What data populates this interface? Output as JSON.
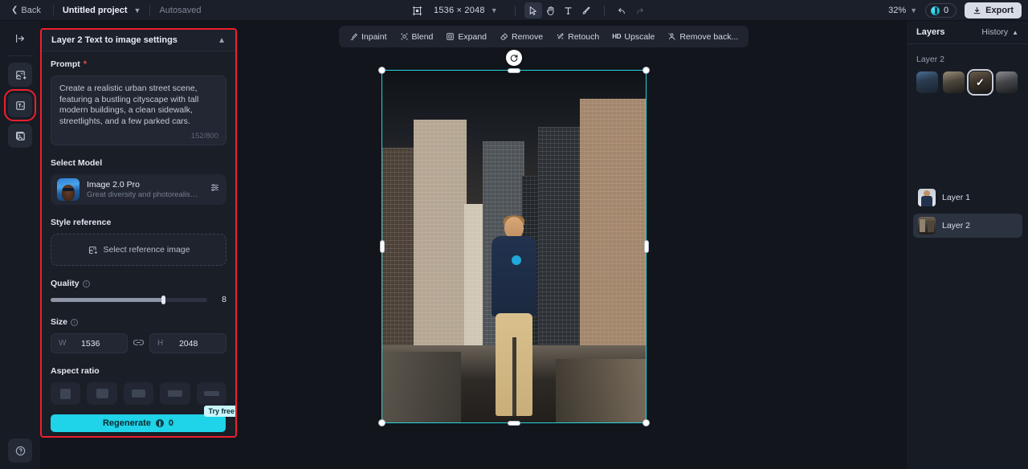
{
  "topbar": {
    "back_label": "Back",
    "project_name": "Untitled project",
    "autosaved_label": "Autosaved",
    "canvas_icon": "canvas-frame-icon",
    "dimensions": "1536 × 2048",
    "tools": [
      {
        "name": "select-tool",
        "glyph": "cursor"
      },
      {
        "name": "hand-tool",
        "glyph": "hand"
      },
      {
        "name": "text-tool",
        "glyph": "T"
      },
      {
        "name": "brush-tool",
        "glyph": "brush"
      }
    ],
    "undo_icon": "undo-icon",
    "redo_icon": "redo-icon",
    "zoom_level": "32%",
    "credits": "0",
    "export_label": "Export"
  },
  "rail": {
    "collapse_icon": "panel-collapse-icon",
    "tools": [
      {
        "name": "image-upload-tool",
        "icon": "image-plus-icon"
      },
      {
        "name": "text-to-image-tool",
        "icon": "text-to-image-icon"
      },
      {
        "name": "image-to-image-tool",
        "icon": "image-to-image-icon"
      }
    ],
    "help_icon": "help-icon"
  },
  "settings_panel": {
    "title": "Layer 2 Text to image settings",
    "collapse_icon": "chevron-up-icon",
    "prompt": {
      "label": "Prompt",
      "required_marker": "*",
      "value": "Create a realistic urban street scene, featuring a bustling cityscape with tall modern buildings, a clean sidewalk, streetlights, and a few parked cars.",
      "counter": "152/800"
    },
    "model": {
      "label": "Select Model",
      "name": "Image 2.0 Pro",
      "description": "Great diversity and photorealism. Of...",
      "settings_icon": "sliders-icon"
    },
    "style_reference": {
      "label": "Style reference",
      "placeholder": "Select reference image",
      "icon": "image-plus-icon"
    },
    "quality": {
      "label": "Quality",
      "info_icon": "info-icon",
      "value": "8",
      "percent": 72
    },
    "size": {
      "label": "Size",
      "info_icon": "info-icon",
      "width_key": "W",
      "width_value": "1536",
      "link_icon": "link-icon",
      "height_key": "H",
      "height_value": "2048"
    },
    "aspect_ratio": {
      "label": "Aspect ratio",
      "options": [
        "1:1",
        "4:5",
        "3:4",
        "3:2",
        "16:9"
      ]
    },
    "regenerate": {
      "label": "Regenerate",
      "cost": "0",
      "coin_icon": "coin-icon",
      "badge": "Try free"
    }
  },
  "edit_toolbar": {
    "items": [
      {
        "label": "Inpaint",
        "icon": "inpaint-icon"
      },
      {
        "label": "Blend",
        "icon": "blend-icon"
      },
      {
        "label": "Expand",
        "icon": "expand-icon"
      },
      {
        "label": "Remove",
        "icon": "eraser-icon"
      },
      {
        "label": "Retouch",
        "icon": "magic-wand-icon"
      },
      {
        "label": "Upscale",
        "icon": "hd-icon",
        "tag": "HD"
      },
      {
        "label": "Remove back...",
        "icon": "remove-background-icon"
      }
    ]
  },
  "canvas": {
    "rotate_icon": "rotate-handle-icon",
    "selection_color": "#25d4dd"
  },
  "layers_panel": {
    "title": "Layers",
    "history_label": "History",
    "history_chevron": "chevron-up-icon",
    "active_layer_label": "Layer 2",
    "history_thumbs": [
      {
        "name": "history-thumb-1",
        "selected": false
      },
      {
        "name": "history-thumb-2",
        "selected": false
      },
      {
        "name": "history-thumb-3",
        "selected": true
      },
      {
        "name": "history-thumb-4",
        "selected": false
      }
    ],
    "layers": [
      {
        "name": "Layer 1",
        "active": false
      },
      {
        "name": "Layer 2",
        "active": true
      }
    ]
  },
  "colors": {
    "accent": "#1fd3e8",
    "selection": "#25d4dd",
    "highlight_border": "#ef1f2e",
    "panel_bg": "#1a1e27",
    "app_bg": "#12151c"
  }
}
